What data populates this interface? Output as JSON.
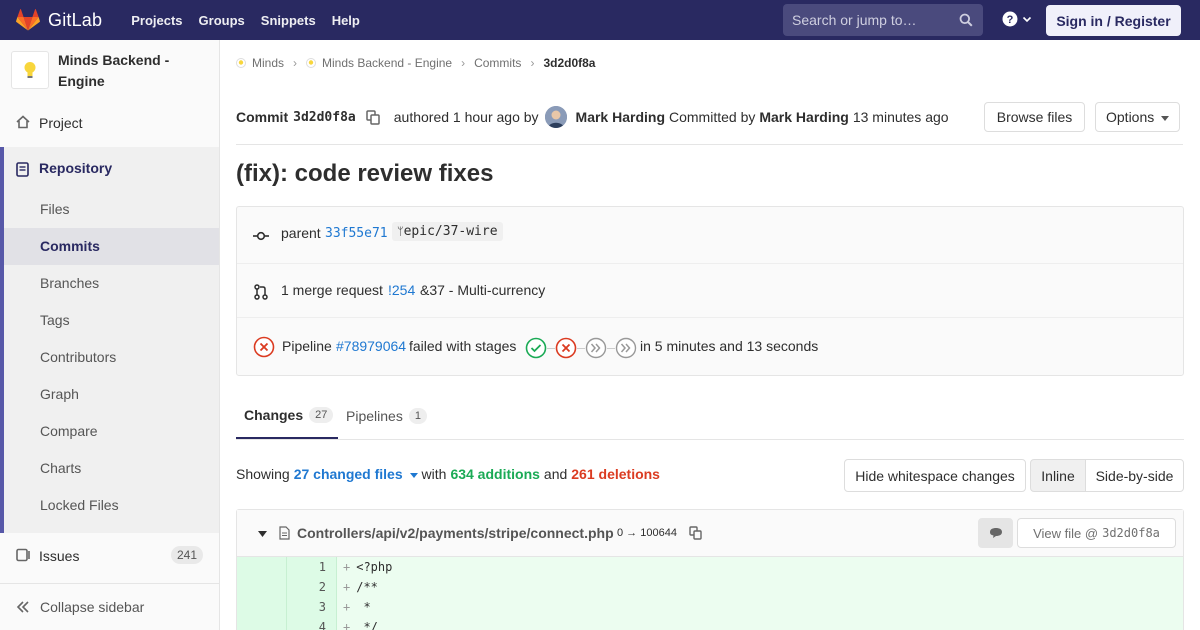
{
  "navbar": {
    "brand": "GitLab",
    "links": [
      "Projects",
      "Groups",
      "Snippets",
      "Help"
    ],
    "search_placeholder": "Search or jump to…",
    "signin": "Sign in / Register"
  },
  "sidebar": {
    "project_name": "Minds Backend - Engine",
    "project": "Project",
    "repository": "Repository",
    "repo_items": [
      "Files",
      "Commits",
      "Branches",
      "Tags",
      "Contributors",
      "Graph",
      "Compare",
      "Charts",
      "Locked Files"
    ],
    "active_item": "Commits",
    "issues": "Issues",
    "issues_count": "241",
    "collapse": "Collapse sidebar"
  },
  "breadcrumbs": [
    "Minds",
    "Minds Backend - Engine",
    "Commits",
    "3d2d0f8a"
  ],
  "commit": {
    "label": "Commit",
    "sha": "3d2d0f8a",
    "authored": "authored 1 hour ago by",
    "author": "Mark Harding",
    "committed_by": "Committed by",
    "committer": "Mark Harding",
    "committed_time": "13 minutes ago",
    "browse_files": "Browse files",
    "options": "Options",
    "title": "(fix): code review fixes"
  },
  "info": {
    "parent_label": "parent",
    "parent_sha": "33f55e71",
    "branch": "epic/37-wire",
    "mr_text": "1 merge request",
    "mr_link": "!254",
    "mr_title": "&37 - Multi-currency",
    "pipeline_label": "Pipeline",
    "pipeline_id": "#78979064",
    "pipeline_status": "failed with stages",
    "pipeline_duration": "in 5 minutes and 13 seconds"
  },
  "tabs": [
    {
      "label": "Changes",
      "count": "27"
    },
    {
      "label": "Pipelines",
      "count": "1"
    }
  ],
  "summary": {
    "showing": "Showing",
    "changed_files": "27 changed files",
    "with": "with",
    "additions": "634 additions",
    "and": "and",
    "deletions": "261 deletions",
    "hide_whitespace": "Hide whitespace changes",
    "inline": "Inline",
    "side_by_side": "Side-by-side"
  },
  "diff": {
    "file_path": "Controllers/api/v2/payments/stripe/connect.php",
    "file_mode": "0 → 100644",
    "view_file": "View file @",
    "view_sha": "3d2d0f8a",
    "lines": [
      {
        "num": "1",
        "code": "<?php"
      },
      {
        "num": "2",
        "code": "/**"
      },
      {
        "num": "3",
        "code": " *"
      },
      {
        "num": "4",
        "code": " */"
      }
    ]
  }
}
